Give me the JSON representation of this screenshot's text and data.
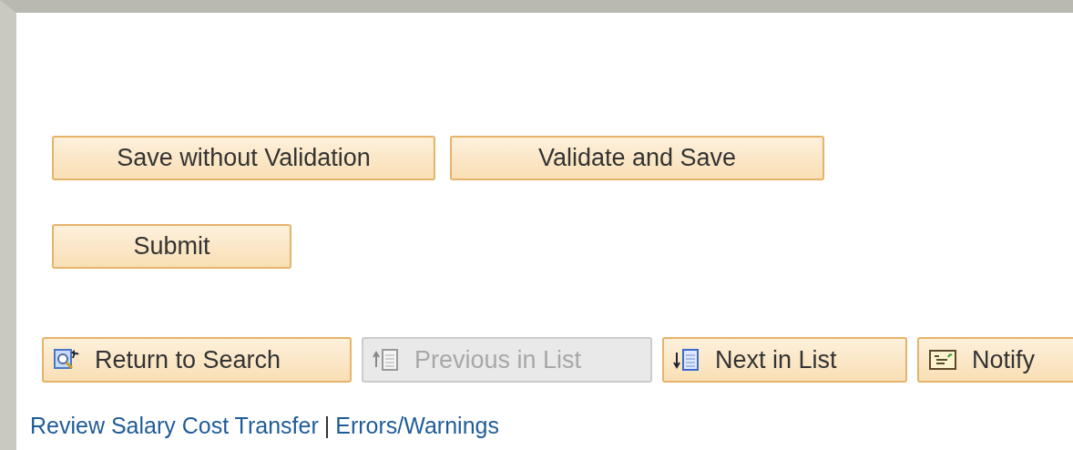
{
  "action_rows": [
    {
      "buttons": [
        {
          "label": "Save without Validation"
        },
        {
          "label": "Validate and Save"
        }
      ]
    },
    {
      "buttons": [
        {
          "label": "Submit"
        }
      ]
    }
  ],
  "toolbar": [
    {
      "kind": "return",
      "label": "Return to Search",
      "disabled": false
    },
    {
      "kind": "previous",
      "label": "Previous in List",
      "disabled": true
    },
    {
      "kind": "next",
      "label": "Next in List",
      "disabled": false
    },
    {
      "kind": "notify",
      "label": "Notify",
      "disabled": false
    }
  ],
  "links": [
    "Review Salary Cost Transfer",
    "Errors/Warnings"
  ],
  "link_separator": "|"
}
